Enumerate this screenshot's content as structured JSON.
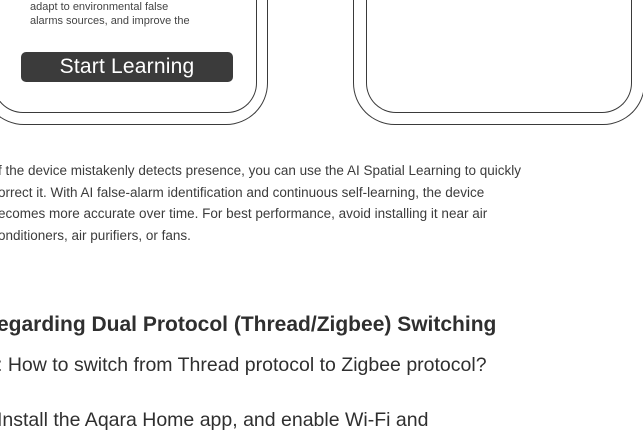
{
  "phone_left": {
    "screen_lines": [
      "adapt to environmental false",
      "alarms sources, and improve the"
    ],
    "button_label": "Start Learning"
  },
  "paragraph_lines": [
    "f the device mistakenly detects presence, you can use the AI Spatial Learning to quickly",
    "orrect it. With AI false-alarm identification and continuous self-learning, the device",
    "ecomes more accurate over time. For best performance, avoid installing it near air",
    "onditioners, air purifiers, or fans."
  ],
  "section_heading": "egarding Dual Protocol (Thread/Zigbee) Switching",
  "question": ": How to switch from Thread protocol to Zigbee protocol?",
  "step_text": "Install the Aqara Home app, and enable Wi-Fi and"
}
